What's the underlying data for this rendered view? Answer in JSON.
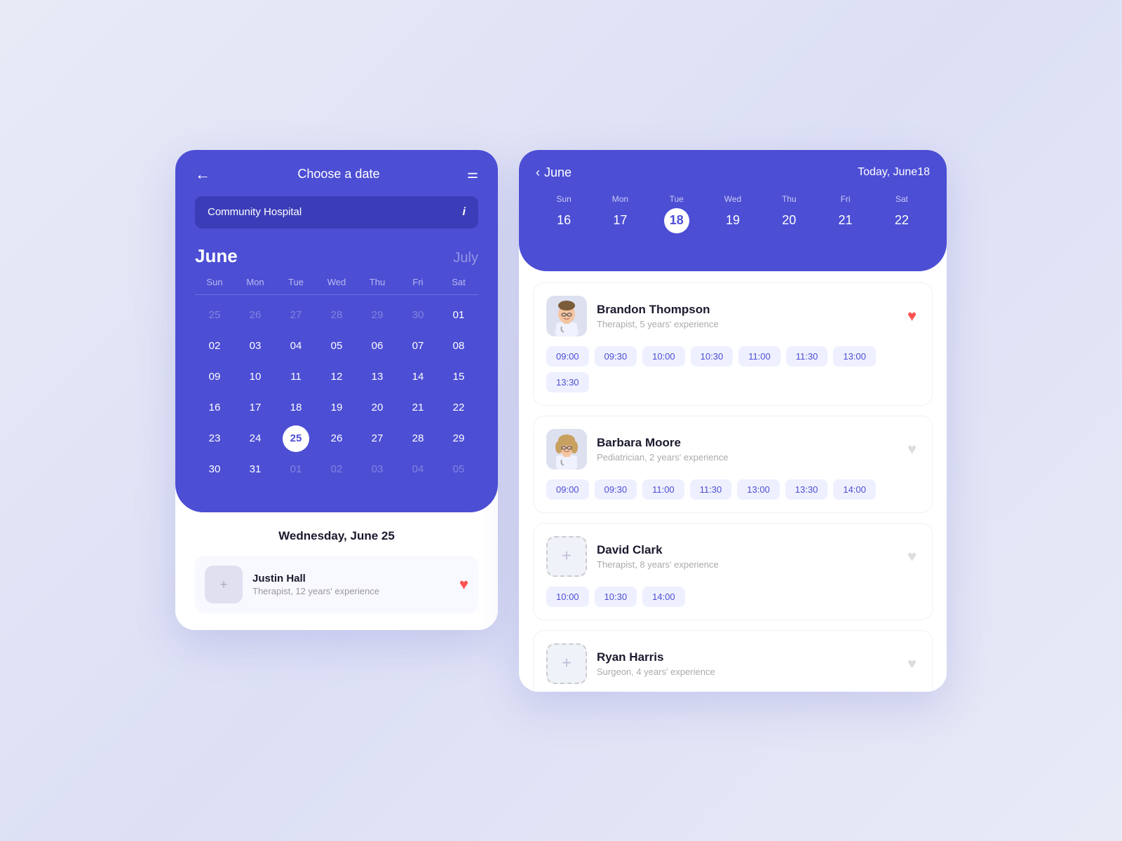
{
  "leftPanel": {
    "header": {
      "backLabel": "←",
      "title": "Choose a date",
      "filterLabel": "⚌"
    },
    "hospital": {
      "name": "Community Hospital",
      "infoLabel": "i"
    },
    "calendar": {
      "currentMonth": "June",
      "nextMonth": "July",
      "dayHeaders": [
        "Sun",
        "Mon",
        "Tue",
        "Wed",
        "Thu",
        "Fri",
        "Sat"
      ],
      "weeks": [
        [
          {
            "day": "25",
            "faded": true
          },
          {
            "day": "26",
            "faded": true
          },
          {
            "day": "27",
            "faded": true
          },
          {
            "day": "28",
            "faded": true
          },
          {
            "day": "29",
            "faded": true
          },
          {
            "day": "30",
            "faded": true
          },
          {
            "day": "01",
            "faded": false
          }
        ],
        [
          {
            "day": "02"
          },
          {
            "day": "03"
          },
          {
            "day": "04"
          },
          {
            "day": "05"
          },
          {
            "day": "06"
          },
          {
            "day": "07"
          },
          {
            "day": "08"
          }
        ],
        [
          {
            "day": "09"
          },
          {
            "day": "10"
          },
          {
            "day": "11"
          },
          {
            "day": "12"
          },
          {
            "day": "13"
          },
          {
            "day": "14"
          },
          {
            "day": "15"
          }
        ],
        [
          {
            "day": "16"
          },
          {
            "day": "17"
          },
          {
            "day": "18"
          },
          {
            "day": "19"
          },
          {
            "day": "20"
          },
          {
            "day": "21"
          },
          {
            "day": "22"
          }
        ],
        [
          {
            "day": "23"
          },
          {
            "day": "24"
          },
          {
            "day": "25",
            "selected": true
          },
          {
            "day": "26"
          },
          {
            "day": "27"
          },
          {
            "day": "28"
          },
          {
            "day": "29"
          }
        ],
        [
          {
            "day": "30"
          },
          {
            "day": "31"
          },
          {
            "day": "01",
            "faded": true
          },
          {
            "day": "02",
            "faded": true
          },
          {
            "day": "03",
            "faded": true
          },
          {
            "day": "04",
            "faded": true
          },
          {
            "day": "05",
            "faded": true
          }
        ]
      ]
    },
    "selectedDate": "Wednesday, June 25",
    "doctorMini": {
      "name": "Justin Hall",
      "specialty": "Therapist, 12 years' experience",
      "favorited": true
    }
  },
  "rightPanel": {
    "weekNav": {
      "monthLabel": "June",
      "todayLabel": "Today, June18"
    },
    "weekDays": [
      {
        "name": "Sun",
        "num": "16",
        "active": false
      },
      {
        "name": "Mon",
        "num": "17",
        "active": false
      },
      {
        "name": "Tue",
        "num": "18",
        "active": true
      },
      {
        "name": "Wed",
        "num": "19",
        "active": false
      },
      {
        "name": "Thu",
        "num": "20",
        "active": false
      },
      {
        "name": "Fri",
        "num": "21",
        "active": false
      },
      {
        "name": "Sat",
        "num": "22",
        "active": false
      }
    ],
    "doctors": [
      {
        "name": "Brandon Thompson",
        "specialty": "Therapist, 5 years' experience",
        "favorited": true,
        "hasPhoto": true,
        "photoType": "male",
        "timeSlots": [
          "09:00",
          "09:30",
          "10:00",
          "10:30",
          "11:00",
          "11:30",
          "13:00",
          "13:30"
        ]
      },
      {
        "name": "Barbara Moore",
        "specialty": "Pediatrician, 2 years' experience",
        "favorited": false,
        "hasPhoto": true,
        "photoType": "female",
        "timeSlots": [
          "09:00",
          "09:30",
          "11:00",
          "11:30",
          "13:00",
          "13:30",
          "14:00"
        ]
      },
      {
        "name": "David Clark",
        "specialty": "Therapist, 8 years' experience",
        "favorited": false,
        "hasPhoto": false,
        "timeSlots": [
          "10:00",
          "10:30",
          "14:00"
        ]
      },
      {
        "name": "Ryan Harris",
        "specialty": "Surgeon, 4 years' experience",
        "favorited": false,
        "hasPhoto": false,
        "timeSlots": []
      }
    ]
  }
}
